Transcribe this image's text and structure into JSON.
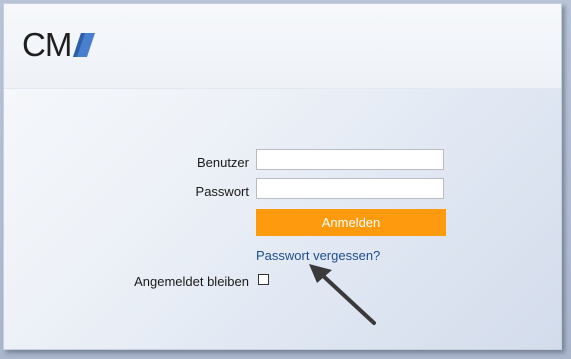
{
  "logo": {
    "text": "CM",
    "accent_color": "#4a7fd0"
  },
  "form": {
    "user_label": "Benutzer",
    "user_value": "",
    "password_label": "Passwort",
    "password_value": "",
    "login_button": "Anmelden",
    "forgot_link": "Passwort vergessen?",
    "remember_label": "Angemeldet bleiben",
    "remember_checked": false
  },
  "colors": {
    "button": "#fe9a0e",
    "link": "#1d4e89",
    "annotation_arrow": "#3a3a3a"
  },
  "annotation": {
    "icon": "arrow-pointer-icon"
  }
}
